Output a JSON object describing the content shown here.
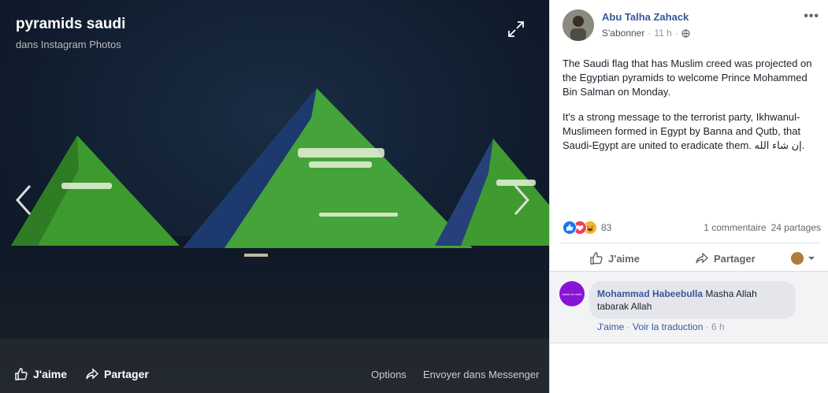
{
  "viewer": {
    "album_title": "pyramids saudi",
    "album_subtitle": "dans Instagram Photos",
    "bottom": {
      "like_label": "J'aime",
      "share_label": "Partager",
      "options_label": "Options",
      "messenger_label": "Envoyer dans Messenger"
    }
  },
  "post": {
    "author": "Abu Talha Zahack",
    "follow_label": "S'abonner",
    "separator": "·",
    "time": "11 h",
    "more_label": "•••",
    "paragraphs": [
      "The Saudi flag that has Muslim creed was projected on the Egyptian pyramids to welcome Prince Mohammed Bin Salman on Monday.",
      "It's a strong message to the terrorist party, Ikhwanul-Muslimeen formed in Egypt by Banna and Qutb, that Saudi-Egypt are united to eradicate them. إن شاء الله."
    ],
    "reaction_count": "83",
    "comment_count": "1 commentaire",
    "share_count": "24 partages",
    "actions": {
      "like_label": "J'aime",
      "share_label": "Partager"
    }
  },
  "comment": {
    "avatar_text": "name for cloth",
    "author": "Mohammad Habeebulla",
    "text": " Masha Allah tabarak Allah",
    "like_link": "J'aime",
    "translate_link": "Voir la traduction",
    "time": "6 h",
    "sep": " · "
  },
  "colors": {
    "link_blue": "#365899",
    "like_blue": "#1877f2",
    "love_red": "#f33e58",
    "haha_yellow": "#f7b125",
    "flag_green": "#3c9a2e"
  }
}
